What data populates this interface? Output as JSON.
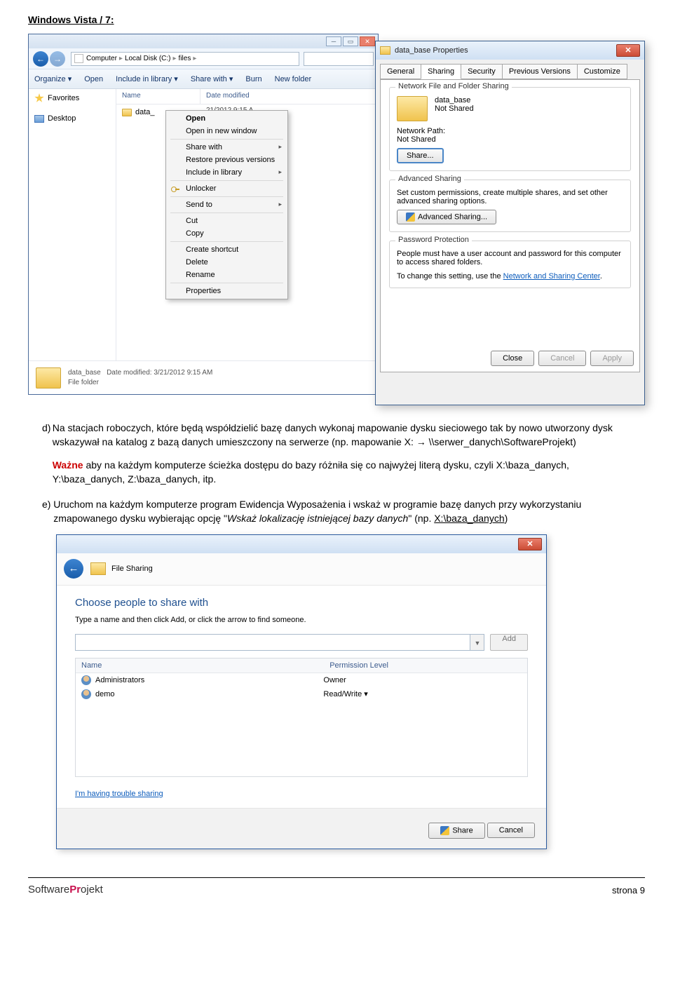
{
  "heading": "Windows Vista / 7:",
  "explorer": {
    "crumbs": [
      "Computer",
      "Local Disk (C:)",
      "files"
    ],
    "toolbar": [
      "Organize ▾",
      "Open",
      "Include in library ▾",
      "Share with ▾",
      "Burn",
      "New folder"
    ],
    "side": {
      "favorites": "Favorites",
      "desktop": "Desktop"
    },
    "cols": {
      "name": "Name",
      "date": "Date modified"
    },
    "row": {
      "name": "data_",
      "date": "21/2012 9:15 A"
    },
    "context": {
      "open": "Open",
      "open_new": "Open in new window",
      "share": "Share with",
      "restore": "Restore previous versions",
      "include": "Include in library",
      "unlocker": "Unlocker",
      "send": "Send to",
      "cut": "Cut",
      "copy": "Copy",
      "shortcut": "Create shortcut",
      "delete": "Delete",
      "rename": "Rename",
      "properties": "Properties"
    },
    "status": {
      "name": "data_base",
      "meta": "Date modified: 3/21/2012 9:15 AM",
      "type": "File folder"
    }
  },
  "props": {
    "title": "data_base Properties",
    "tabs": [
      "General",
      "Sharing",
      "Security",
      "Previous Versions",
      "Customize"
    ],
    "g1": {
      "title": "Network File and Folder Sharing",
      "name": "data_base",
      "state": "Not Shared",
      "pathlabel": "Network Path:",
      "path": "Not Shared",
      "btn": "Share..."
    },
    "g2": {
      "title": "Advanced Sharing",
      "text": "Set custom permissions, create multiple shares, and set other advanced sharing options.",
      "btn": "Advanced Sharing..."
    },
    "g3": {
      "title": "Password Protection",
      "text1": "People must have a user account and password for this computer to access shared folders.",
      "text2a": "To change this setting, use the ",
      "link": "Network and Sharing Center",
      "text2b": "."
    },
    "buttons": {
      "close": "Close",
      "cancel": "Cancel",
      "apply": "Apply"
    }
  },
  "text": {
    "d_label": "d)",
    "d_body1": "Na stacjach roboczych, które będą współdzielić bazę danych wykonaj mapowanie dysku sieciowego tak by nowo utworzony dysk wskazywał na katalog z bazą danych umieszczony na serwerze (np. mapowanie X: → \\\\serwer_danych\\SoftwareProjekt)",
    "important": "Ważne",
    "d_body2": " aby na każdym komputerze ścieżka dostępu do bazy różniła się co najwyżej literą dysku, czyli X:\\baza_danych, Y:\\baza_danych, Z:\\baza_danych, itp.",
    "e_label": "e)",
    "e_body1": "Uruchom na każdym komputerze program Ewidencja Wyposażenia i wskaż w programie bazę danych przy wykorzystaniu zmapowanego dysku wybierając opcję \"",
    "e_italic": "Wskaż lokalizację istniejącej bazy danych",
    "e_body2": "\" (np. ",
    "e_link": "X:\\baza_danych",
    "e_body3": ")"
  },
  "fs": {
    "title": "File Sharing",
    "heading": "Choose people to share with",
    "sub": "Type a name and then click Add, or click the arrow to find someone.",
    "add": "Add",
    "cols": {
      "name": "Name",
      "perm": "Permission Level"
    },
    "rows": [
      {
        "name": "Administrators",
        "perm": "Owner"
      },
      {
        "name": "demo",
        "perm": "Read/Write ▾"
      }
    ],
    "trouble": "I'm having trouble sharing",
    "share": "Share",
    "cancel": "Cancel"
  },
  "footer": {
    "page": "strona 9"
  }
}
